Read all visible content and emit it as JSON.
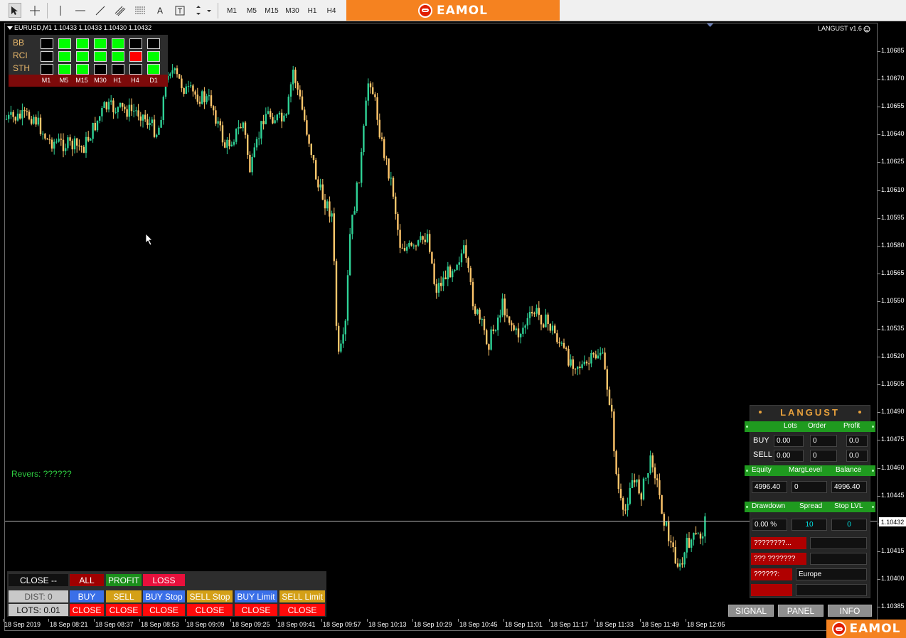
{
  "toolbar": {
    "timeframes": [
      "M1",
      "M5",
      "M15",
      "M30",
      "H1",
      "H4"
    ],
    "text_tool_label": "A"
  },
  "brand": {
    "name": "EAMOL"
  },
  "chart": {
    "symbol_info": "EURUSD,M1  1.10433 1.10433 1.10430 1.10432",
    "ea_name": "LANGUST v1.6",
    "current_price": "1.10432",
    "price_ticks": [
      "1.10685",
      "1.10670",
      "1.10655",
      "1.10640",
      "1.10625",
      "1.10610",
      "1.10595",
      "1.10580",
      "1.10565",
      "1.10550",
      "1.10535",
      "1.10520",
      "1.10505",
      "1.10490",
      "1.10475",
      "1.10460",
      "1.10445",
      "1.10430",
      "1.10415",
      "1.10400",
      "1.10385"
    ],
    "time_ticks": [
      "18 Sep 2019",
      "18 Sep 08:21",
      "18 Sep 08:37",
      "18 Sep 08:53",
      "18 Sep 09:09",
      "18 Sep 09:25",
      "18 Sep 09:41",
      "18 Sep 09:57",
      "18 Sep 10:13",
      "18 Sep 10:29",
      "18 Sep 10:45",
      "18 Sep 11:01",
      "18 Sep 11:17",
      "18 Sep 11:33",
      "18 Sep 11:49",
      "18 Sep 12:05"
    ],
    "colors": {
      "bull": "#2fd296",
      "bear": "#ffc66b",
      "background": "#000000"
    }
  },
  "signal_matrix": {
    "rows": [
      "BB",
      "RCI",
      "STH"
    ],
    "timeframes": [
      "M1",
      "M5",
      "M15",
      "M30",
      "H1",
      "H4",
      "D1"
    ],
    "states": [
      [
        "off",
        "on",
        "on",
        "on",
        "on",
        "off",
        "off"
      ],
      [
        "off",
        "on",
        "on",
        "on",
        "on",
        "sell",
        "on"
      ],
      [
        "off",
        "on",
        "on",
        "off",
        "off",
        "off",
        "on"
      ]
    ]
  },
  "revers_label": "Revers: ??????",
  "trade_panel": {
    "close_label": "CLOSE --",
    "all": "ALL",
    "profit": "PROFIT",
    "loss": "LOSS",
    "dist": "DIST: 0",
    "lots": "LOTS: 0.01",
    "orders": [
      "BUY",
      "SELL",
      "BUY Stop",
      "SELL Stop",
      "BUY Limit",
      "SELL Limit"
    ],
    "close": "CLOSE"
  },
  "langust": {
    "title": "LANGUST",
    "headers1": [
      "Lots",
      "Order",
      "Profit"
    ],
    "buy_label": "BUY",
    "sell_label": "SELL",
    "buy": [
      "0.00",
      "0",
      "0.0"
    ],
    "sell": [
      "0.00",
      "0",
      "0.0"
    ],
    "headers2": [
      "Equity",
      "MargLevel",
      "Balance"
    ],
    "equity": "4996.40",
    "marg_level": "0",
    "balance": "4996.40",
    "headers3": [
      "Drawdown",
      "Spread",
      "Stop LVL"
    ],
    "drawdown": "0.00 %",
    "spread": "10",
    "stop_lvl": "0",
    "info1": "????????...",
    "info2": "??? ???????",
    "session_label": "??????:",
    "session": "Europe"
  },
  "bottom_buttons": {
    "signal": "SIGNAL",
    "panel": "PANEL",
    "info": "INFO"
  }
}
